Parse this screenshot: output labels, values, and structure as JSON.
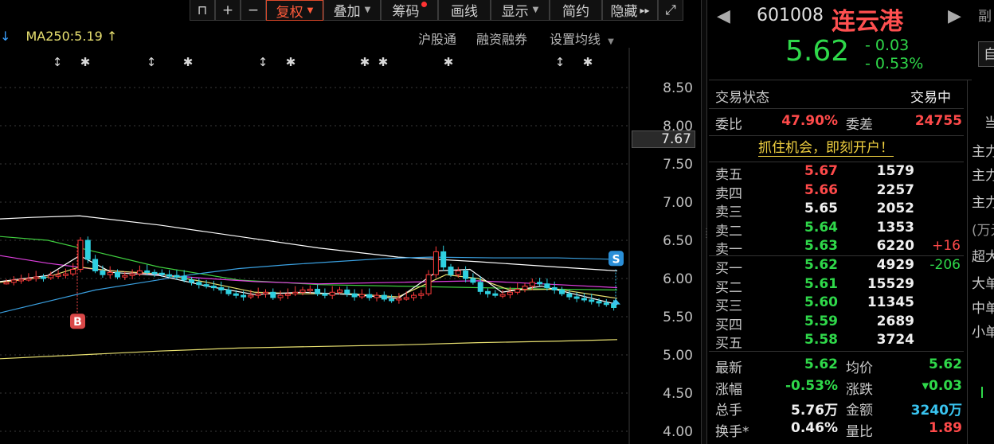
{
  "toolbar": {
    "items": [
      {
        "label": "",
        "icon": "lock-open-icon"
      },
      {
        "label": "",
        "icon": "plus-icon"
      },
      {
        "label": "",
        "icon": "minus-icon"
      },
      {
        "label": "复权",
        "caret": true,
        "active": true
      },
      {
        "label": "叠加",
        "caret": true
      },
      {
        "label": "筹码",
        "dot": true
      },
      {
        "label": "画线"
      },
      {
        "label": "显示",
        "caret": true
      },
      {
        "label": "简约"
      },
      {
        "label": "隐藏",
        "icon": "double-chevron-right-icon"
      },
      {
        "label": "",
        "icon": "expand-icon"
      }
    ]
  },
  "indicator": {
    "ma250_label": "MA250:5.19"
  },
  "top_links": {
    "hgt": "沪股通",
    "margin": "融资融券",
    "ma_settings": "设置均线"
  },
  "chart": {
    "y_ticks": [
      "8.50",
      "8.00",
      "7.50",
      "7.00",
      "6.50",
      "6.00",
      "5.50",
      "5.00",
      "4.50",
      "4.00"
    ],
    "current_price_tag": "7.67",
    "buy_marker": "B",
    "sell_marker": "S",
    "colors": {
      "up": "#ff3b3b",
      "down": "#2fd0e0",
      "ma5": "#ffffff",
      "ma10": "#e8e070",
      "ma20": "#e040e0",
      "ma30": "#40d040",
      "ma60": "#3aa0e0",
      "ma120": "#ffffff",
      "ma250": "#e8e070"
    }
  },
  "quote": {
    "code": "601008",
    "name": "连云港",
    "price": "5.62",
    "change": "- 0.03",
    "change_pct": "- 0.53%",
    "side_button": "自"
  },
  "status": {
    "trade_state_label": "交易状态",
    "trade_state_value": "交易中",
    "weibi_label": "委比",
    "weibi_value": "47.90%",
    "weicha_label": "委差",
    "weicha_value": "24755"
  },
  "promo": "抓住机会，即刻开户！",
  "order_book": {
    "asks": [
      {
        "label": "卖五",
        "price": "5.67",
        "vol": "1579",
        "chg": "",
        "pc": "red"
      },
      {
        "label": "卖四",
        "price": "5.66",
        "vol": "2257",
        "chg": "",
        "pc": "red"
      },
      {
        "label": "卖三",
        "price": "5.65",
        "vol": "2052",
        "chg": "",
        "pc": "white"
      },
      {
        "label": "卖二",
        "price": "5.64",
        "vol": "1353",
        "chg": "",
        "pc": "green"
      },
      {
        "label": "卖一",
        "price": "5.63",
        "vol": "6220",
        "chg": "+16",
        "pc": "green"
      }
    ],
    "bids": [
      {
        "label": "买一",
        "price": "5.62",
        "vol": "4929",
        "chg": "-206",
        "pc": "green"
      },
      {
        "label": "买二",
        "price": "5.61",
        "vol": "15529",
        "chg": "",
        "pc": "green"
      },
      {
        "label": "买三",
        "price": "5.60",
        "vol": "11345",
        "chg": "",
        "pc": "green"
      },
      {
        "label": "买四",
        "price": "5.59",
        "vol": "2689",
        "chg": "",
        "pc": "green"
      },
      {
        "label": "买五",
        "price": "5.58",
        "vol": "3724",
        "chg": "",
        "pc": "green"
      }
    ]
  },
  "stats": [
    {
      "l1": "最新",
      "v1": "5.62",
      "c1": "green",
      "l2": "均价",
      "v2": "5.62",
      "c2": "green"
    },
    {
      "l1": "涨幅",
      "v1": "-0.53%",
      "c1": "green",
      "l2": "涨跌",
      "v2": "▾0.03",
      "c2": "green"
    },
    {
      "l1": "总手",
      "v1": "5.76万",
      "c1": "white",
      "l2": "金额",
      "v2": "3240万",
      "c2": "cyan"
    },
    {
      "l1": "换手*",
      "v1": "0.46%",
      "c1": "white",
      "l2": "量比",
      "v2": "1.89",
      "c2": "red"
    }
  ],
  "far_right": {
    "top": "副",
    "tab": "当",
    "rows": [
      "主力",
      "主力",
      "主力",
      "(万元",
      "超大",
      "大单",
      "中单",
      "小单"
    ]
  }
}
